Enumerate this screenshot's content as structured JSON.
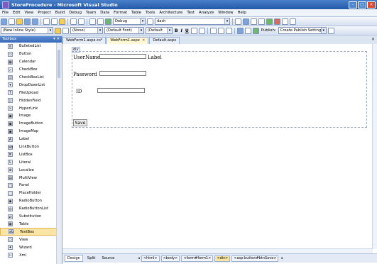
{
  "window": {
    "title": "StoreProcedure - Microsoft Visual Studio"
  },
  "menu": [
    "File",
    "Edit",
    "View",
    "Project",
    "Build",
    "Debug",
    "Team",
    "Data",
    "Format",
    "Table",
    "Tools",
    "Architecture",
    "Test",
    "Analyze",
    "Window",
    "Help"
  ],
  "toolbar1": {
    "config": "Debug",
    "find": "dash"
  },
  "toolbar2": {
    "style": "(New Inline Style)",
    "block": "(None)",
    "font": "(Default Font)",
    "size": "(Default",
    "bold": "B",
    "italic": "I",
    "underline": "U",
    "publish_label": "Publish:",
    "publish_value": "Create Publish Settings"
  },
  "toolbox": {
    "title": "Toolbox",
    "pin": "▾ ✕",
    "items": [
      {
        "label": "BulletedList",
        "icon": "list-icon"
      },
      {
        "label": "Button",
        "icon": "button-icon"
      },
      {
        "label": "Calendar",
        "icon": "calendar-icon"
      },
      {
        "label": "CheckBox",
        "icon": "checkbox-icon"
      },
      {
        "label": "CheckBoxList",
        "icon": "checkbox-list-icon"
      },
      {
        "label": "DropDownList",
        "icon": "dropdown-icon"
      },
      {
        "label": "FileUpload",
        "icon": "file-upload-icon"
      },
      {
        "label": "HiddenField",
        "icon": "hidden-field-icon"
      },
      {
        "label": "HyperLink",
        "icon": "hyperlink-icon"
      },
      {
        "label": "Image",
        "icon": "image-icon"
      },
      {
        "label": "ImageButton",
        "icon": "image-button-icon"
      },
      {
        "label": "ImageMap",
        "icon": "image-map-icon"
      },
      {
        "label": "Label",
        "icon": "label-icon"
      },
      {
        "label": "LinkButton",
        "icon": "link-button-icon"
      },
      {
        "label": "ListBox",
        "icon": "listbox-icon"
      },
      {
        "label": "Literal",
        "icon": "literal-icon"
      },
      {
        "label": "Localize",
        "icon": "localize-icon"
      },
      {
        "label": "MultiView",
        "icon": "multiview-icon"
      },
      {
        "label": "Panel",
        "icon": "panel-icon"
      },
      {
        "label": "PlaceHolder",
        "icon": "placeholder-icon"
      },
      {
        "label": "RadioButton",
        "icon": "radio-icon"
      },
      {
        "label": "RadioButtonList",
        "icon": "radio-list-icon"
      },
      {
        "label": "Substitution",
        "icon": "substitution-icon"
      },
      {
        "label": "Table",
        "icon": "table-icon"
      },
      {
        "label": "TextBox",
        "icon": "textbox-icon",
        "selected": true
      },
      {
        "label": "View",
        "icon": "view-icon"
      },
      {
        "label": "Wizard",
        "icon": "wizard-icon"
      },
      {
        "label": "Xml",
        "icon": "xml-icon"
      }
    ]
  },
  "tabs": [
    {
      "label": "WebForm1.aspx.cs*",
      "active": false
    },
    {
      "label": "WebForm1.aspx",
      "active": true,
      "close": "✕"
    },
    {
      "label": "Default.aspx",
      "active": false
    }
  ],
  "doc_close": "✕",
  "design": {
    "div_tag": "div",
    "username_label": "UserName",
    "label_control": "Label",
    "password_label": "Password",
    "id_label": "ID",
    "save_button": "Save"
  },
  "status": {
    "design": "Design",
    "split": "Split",
    "source": "Source",
    "crumbs": [
      "<html>",
      "<body>",
      "<form#form1>",
      "<div>",
      "<asp:button#btnSave>"
    ],
    "selected_crumb": "<div>"
  },
  "colors": {
    "titlebar": "#2258a8",
    "selection": "#fbe5a4"
  }
}
